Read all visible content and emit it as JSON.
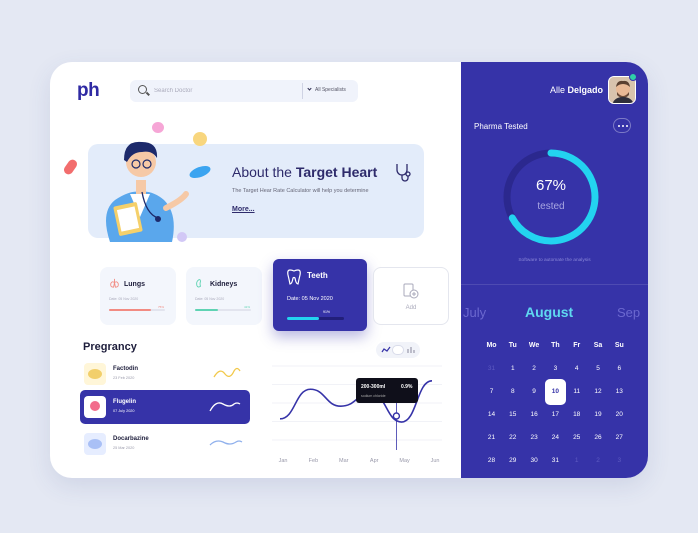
{
  "logo": "ph",
  "search": {
    "placeholder": "Search Doctor",
    "specialist": "All Specialists"
  },
  "hero": {
    "title_prefix": "About the ",
    "title_bold": "Target Heart",
    "subtitle": "The Target Hear Rate Calculator will help you determine",
    "more": "More..."
  },
  "organs": [
    {
      "name": "Lungs",
      "sub": "Date: 05 Nov 2020",
      "pct": "75%",
      "pct_value": 0.75,
      "color": "#f28b82"
    },
    {
      "name": "Kidneys",
      "sub": "Date: 05 Nov 2020",
      "pct": "41%",
      "pct_value": 0.41,
      "color": "#5fd3b3"
    }
  ],
  "teeth": {
    "name": "Teeth",
    "date": "Date: 05 Nov 2020",
    "pct": "91%",
    "pct_value": 0.57
  },
  "add": {
    "label": "Add"
  },
  "pregnancy": {
    "title": "Pregrancy",
    "items": [
      {
        "name": "Factodin",
        "date": "23 Feb 2020"
      },
      {
        "name": "Flugelin",
        "date": "07 July 2020"
      },
      {
        "name": "Docarbazine",
        "date": "25 Mar 2020"
      }
    ]
  },
  "chart_data": {
    "type": "line",
    "categories": [
      "Jan",
      "Feb",
      "Mar",
      "Apr",
      "May",
      "Jun"
    ],
    "values": [
      20,
      48,
      32,
      44,
      17,
      56
    ],
    "tooltip": {
      "value": "200-300ml",
      "pct": "0.9%",
      "sub": "sodium chloride"
    }
  },
  "user": {
    "first": "Alle ",
    "last": "Delgado"
  },
  "pharma": {
    "title": "Pharma Tested",
    "pct": "67%",
    "pct_value": 0.67,
    "sub": "tested",
    "note": "Software to automate the analysis"
  },
  "calendar": {
    "prev": "July",
    "current": "August",
    "next": "Sep",
    "weekdays": [
      "Mo",
      "Tu",
      "We",
      "Th",
      "Fr",
      "Sa",
      "Su"
    ],
    "weeks": [
      [
        "31",
        "1",
        "2",
        "3",
        "4",
        "5",
        "6"
      ],
      [
        "7",
        "8",
        "9",
        "10",
        "11",
        "12",
        "13"
      ],
      [
        "14",
        "15",
        "16",
        "17",
        "18",
        "19",
        "20"
      ],
      [
        "21",
        "22",
        "23",
        "24",
        "25",
        "26",
        "27"
      ],
      [
        "28",
        "29",
        "30",
        "31",
        "1",
        "2",
        "3"
      ]
    ],
    "selected": "10"
  },
  "colors": {
    "primary": "#3633a8",
    "accent": "#23d3f0"
  }
}
